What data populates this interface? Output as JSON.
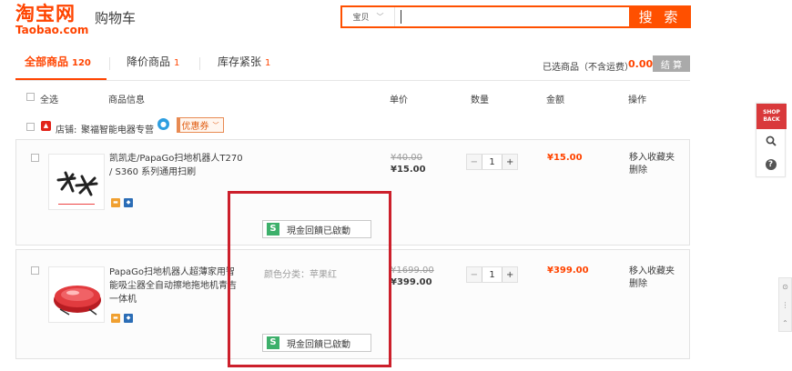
{
  "header": {
    "logo_cn": "淘宝网",
    "logo_en": "Taobao.com",
    "title": "购物车",
    "search_type": "宝贝",
    "search_value": "",
    "search_button": "搜 索"
  },
  "tabs": [
    {
      "label": "全部商品",
      "count": "120"
    },
    {
      "label": "降价商品",
      "count": "1"
    },
    {
      "label": "库存紧张",
      "count": "1"
    }
  ],
  "summary": {
    "label": "已选商品（不含运费）",
    "amount": "0.00",
    "checkout": "结 算"
  },
  "columns": {
    "select_all": "全选",
    "info": "商品信息",
    "unit_price": "单价",
    "quantity": "数量",
    "amount": "金额",
    "actions": "操作"
  },
  "shop": {
    "label": "店铺:",
    "name": "聚福智能电器专营",
    "coupon": "优惠券"
  },
  "items": [
    {
      "title": "凯凯走/PapaGo扫地机器人T270 / S360 系列通用扫刷",
      "spec": "",
      "price_orig": "¥40.00",
      "price_now": "¥15.00",
      "qty": "1",
      "total": "¥15.00",
      "op_fav": "移入收藏夹",
      "op_del": "删除",
      "cashback": "現金回饋已啟動"
    },
    {
      "title": "PapaGo扫地机器人超薄家用智能吸尘器全自动擦地拖地机青吉一体机",
      "spec": "颜色分类：苹果红",
      "price_orig": "¥1699.00",
      "price_now": "¥399.00",
      "qty": "1",
      "total": "¥399.00",
      "op_fav": "移入收藏夹",
      "op_del": "删除",
      "cashback": "現金回饋已啟動"
    }
  ],
  "side": {
    "shop_back": "SHOP BACK"
  },
  "colors": {
    "accent": "#ff5000",
    "price": "#ff4400",
    "highlight": "#cc1f2b",
    "cashback_badge": "#3db06b"
  }
}
